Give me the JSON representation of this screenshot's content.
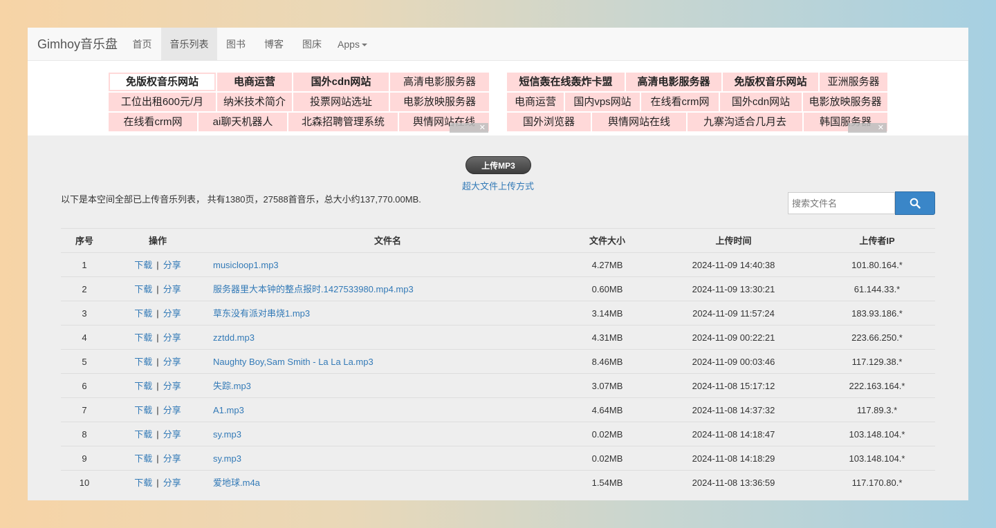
{
  "nav": {
    "brand": "Gimhoy音乐盘",
    "items": [
      {
        "label": "首页",
        "active": false
      },
      {
        "label": "音乐列表",
        "active": true
      },
      {
        "label": "图书",
        "active": false
      },
      {
        "label": "博客",
        "active": false
      },
      {
        "label": "图床",
        "active": false
      },
      {
        "label": "Apps",
        "active": false,
        "dropdown": true
      }
    ]
  },
  "ads": {
    "left": [
      [
        "免版权音乐网站",
        "电商运营",
        "国外cdn网站",
        "高清电影服务器"
      ],
      [
        "工位出租600元/月",
        "纳米技术简介",
        "投票网站选址",
        "电影放映服务器"
      ],
      [
        "在线看crm网",
        "ai聊天机器人",
        "北森招聘管理系统",
        "舆情网站在线"
      ]
    ],
    "right": [
      [
        "短信轰在线轰炸卡盟",
        "高清电影服务器",
        "免版权音乐网站",
        "亚洲服务器"
      ],
      [
        "电商运营",
        "国内vps网站",
        "在线看crm网",
        "国外cdn网站",
        "电影放映服务器"
      ],
      [
        "国外浏览器",
        "舆情网站在线",
        "九寨沟适合几月去",
        "韩国服务器"
      ]
    ],
    "close_glyph": "✕"
  },
  "upload": {
    "button_label": "上传MP3",
    "bigfile_label": "超大文件上传方式"
  },
  "summary": "以下是本空间全部已上传音乐列表， 共有1380页，27588首音乐，总大小约137,770.00MB.",
  "search": {
    "placeholder": "搜索文件名",
    "icon": "search-icon"
  },
  "table": {
    "headers": {
      "idx": "序号",
      "op": "操作",
      "name": "文件名",
      "size": "文件大小",
      "time": "上传时间",
      "ip": "上传者IP"
    },
    "download_label": "下载",
    "separator": "|",
    "share_label": "分享",
    "rows": [
      {
        "idx": "1",
        "name": "musicloop1.mp3",
        "size": "4.27MB",
        "time": "2024-11-09 14:40:38",
        "ip": "101.80.164.*"
      },
      {
        "idx": "2",
        "name": "服务器里大本钟的整点报时.1427533980.mp4.mp3",
        "size": "0.60MB",
        "time": "2024-11-09 13:30:21",
        "ip": "61.144.33.*"
      },
      {
        "idx": "3",
        "name": "草东没有派对串烧1.mp3",
        "size": "3.14MB",
        "time": "2024-11-09 11:57:24",
        "ip": "183.93.186.*"
      },
      {
        "idx": "4",
        "name": "zztdd.mp3",
        "size": "4.31MB",
        "time": "2024-11-09 00:22:21",
        "ip": "223.66.250.*"
      },
      {
        "idx": "5",
        "name": "Naughty Boy,Sam Smith - La La La.mp3",
        "size": "8.46MB",
        "time": "2024-11-09 00:03:46",
        "ip": "117.129.38.*"
      },
      {
        "idx": "6",
        "name": "失踪.mp3",
        "size": "3.07MB",
        "time": "2024-11-08 15:17:12",
        "ip": "222.163.164.*"
      },
      {
        "idx": "7",
        "name": "A1.mp3",
        "size": "4.64MB",
        "time": "2024-11-08 14:37:32",
        "ip": "117.89.3.*"
      },
      {
        "idx": "8",
        "name": "sy.mp3",
        "size": "0.02MB",
        "time": "2024-11-08 14:18:47",
        "ip": "103.148.104.*"
      },
      {
        "idx": "9",
        "name": "sy.mp3",
        "size": "0.02MB",
        "time": "2024-11-08 14:18:29",
        "ip": "103.148.104.*"
      },
      {
        "idx": "10",
        "name": "爱地球.m4a",
        "size": "1.54MB",
        "time": "2024-11-08 13:36:59",
        "ip": "117.170.80.*"
      }
    ]
  }
}
